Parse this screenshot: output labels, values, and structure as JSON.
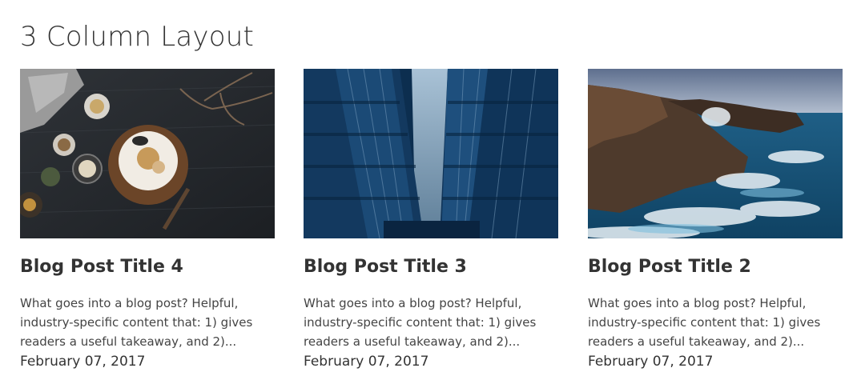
{
  "section": {
    "title": "3 Column Layout"
  },
  "posts": [
    {
      "title": "Blog Post Title 4",
      "excerpt": "What goes into a blog post? Helpful, industry-specific content that: 1) gives readers a useful takeaway, and 2)...",
      "date": "February 07, 2017",
      "image": "food-flatlay-photo"
    },
    {
      "title": "Blog Post Title 3",
      "excerpt": "What goes into a blog post? Helpful, industry-specific content that: 1) gives readers a useful takeaway, and 2)...",
      "date": "February 07, 2017",
      "image": "city-skyscrapers-photo"
    },
    {
      "title": "Blog Post Title 2",
      "excerpt": "What goes into a blog post? Helpful, industry-specific content that: 1) gives readers a useful takeaway, and 2)...",
      "date": "February 07, 2017",
      "image": "ocean-cliffs-photo"
    }
  ]
}
